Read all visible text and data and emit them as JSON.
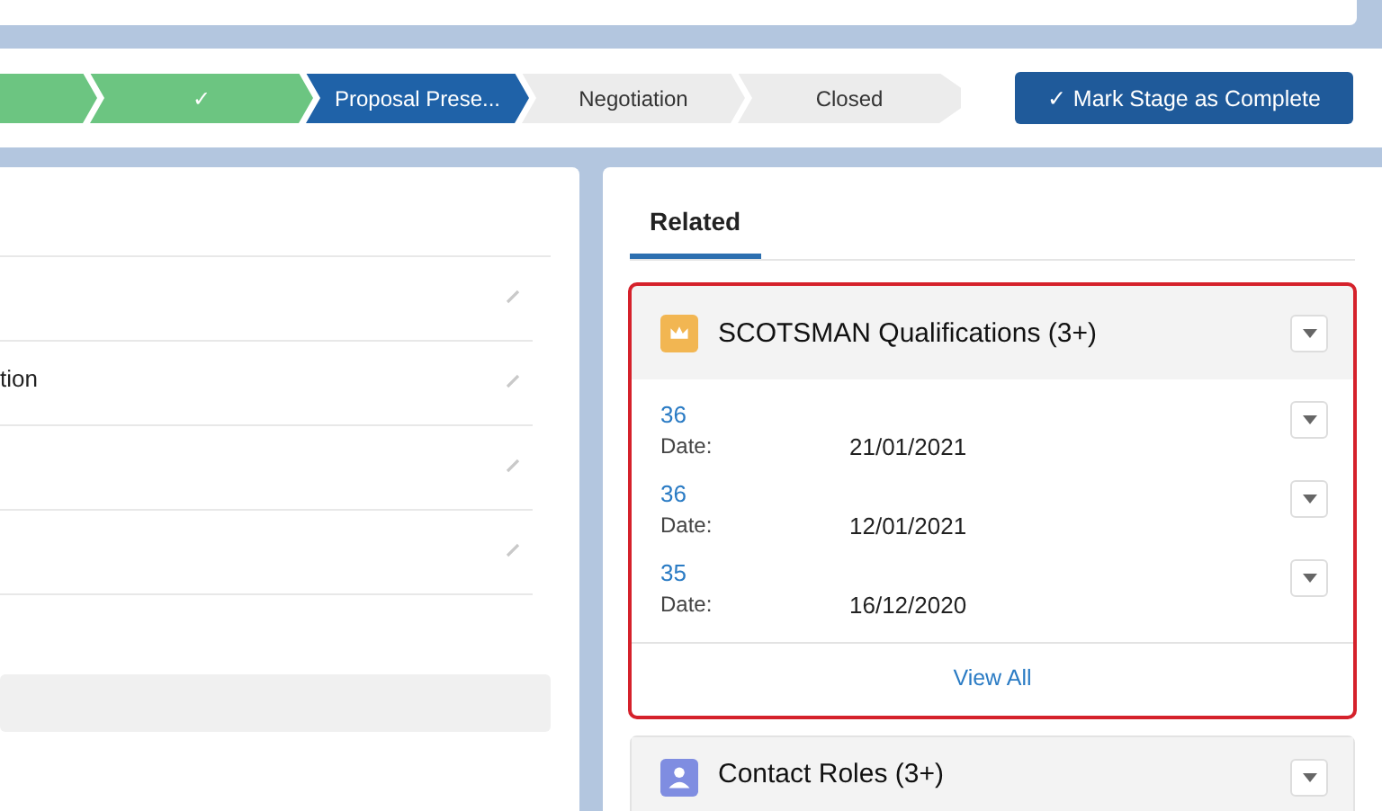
{
  "path": {
    "stages": [
      {
        "kind": "complete"
      },
      {
        "kind": "complete",
        "check": "✓"
      },
      {
        "kind": "current",
        "label": "Proposal Prese..."
      },
      {
        "kind": "incomplete",
        "label": "Negotiation"
      },
      {
        "kind": "incomplete",
        "label": "Closed"
      }
    ],
    "button": {
      "icon": "✓",
      "label": "Mark Stage as Complete"
    }
  },
  "details": {
    "fields": [
      {
        "editable": true
      },
      {
        "value": "tion",
        "editable": true
      },
      {
        "editable": true
      },
      {
        "editable": true
      }
    ]
  },
  "related": {
    "tabs": [
      {
        "label": "Related",
        "selected": true
      }
    ],
    "cards": [
      {
        "title": "SCOTSMAN Qualifications (3+)",
        "highlighted": true,
        "kind": "qualification",
        "records": [
          {
            "name": "36",
            "date_label": "Date:",
            "date": "21/01/2021"
          },
          {
            "name": "36",
            "date_label": "Date:",
            "date": "12/01/2021"
          },
          {
            "name": "35",
            "date_label": "Date:",
            "date": "16/12/2020"
          }
        ],
        "footer": "View All"
      },
      {
        "title": "Contact Roles (3+)",
        "highlighted": false,
        "kind": "contact"
      }
    ]
  }
}
